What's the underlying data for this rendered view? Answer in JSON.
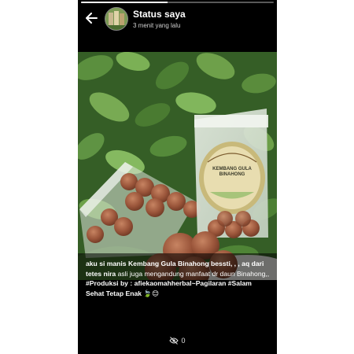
{
  "header": {
    "title": "Status saya",
    "subtitle": "3 menit yang lalu"
  },
  "status": {
    "progress": 0.45
  },
  "product": {
    "label_line1": "KEMBANG GULA",
    "label_line2": "BINAHONG"
  },
  "caption": {
    "part1": "aku si manis Kembang Gula Binahong bessti, , , aq dari tetes",
    "part2": "nira",
    "part3": "asli juga mengandung manfaat dr daun Binahong,,",
    "part4": "#Produksi by : afiekaomahherbal~Pagilaran #Salam Sehat Tetap Enak",
    "emoji": "🍃😊"
  },
  "footer": {
    "views": "0"
  },
  "colors": {
    "background": "#000000",
    "text": "#ffffff",
    "leaf_dark": "#2f5a22",
    "leaf_light": "#6aa048",
    "candy": "#a0583c"
  }
}
